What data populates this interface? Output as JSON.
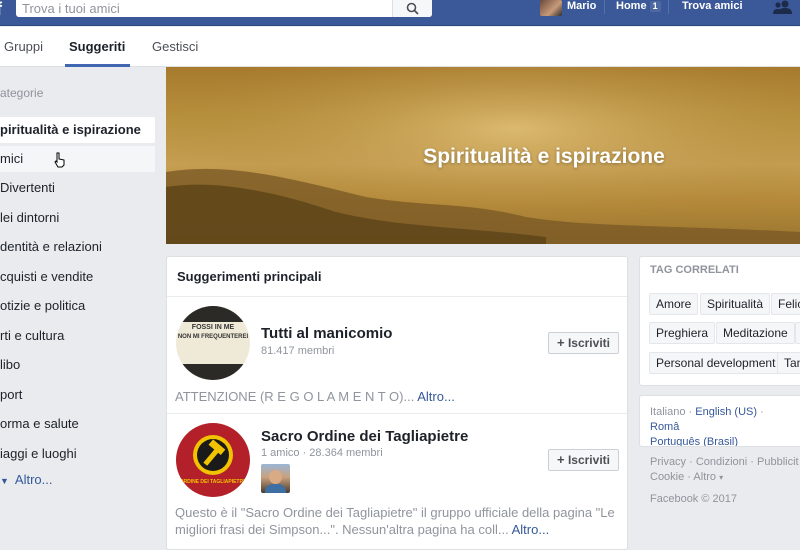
{
  "topbar": {
    "logo": "f",
    "search_placeholder": "Trova i tuoi amici",
    "user_name": "Mario",
    "home_label": "Home",
    "home_badge": "1",
    "find_friends_label": "Trova amici"
  },
  "tabs": [
    {
      "label": "Gruppi"
    },
    {
      "label": "Suggeriti"
    },
    {
      "label": "Gestisci"
    }
  ],
  "sidebar": {
    "title": "ategorie",
    "items": [
      {
        "label": "piritualità e ispirazione"
      },
      {
        "label": "mici"
      },
      {
        "label": "Divertenti"
      },
      {
        "label": "lei dintorni"
      },
      {
        "label": "dentità e relazioni"
      },
      {
        "label": "cquisti e vendite"
      },
      {
        "label": "otizie e politica"
      },
      {
        "label": "rti e cultura"
      },
      {
        "label": "libo"
      },
      {
        "label": "port"
      },
      {
        "label": "orma e salute"
      },
      {
        "label": "iaggi e luoghi"
      }
    ],
    "more_label": "Altro..."
  },
  "banner": {
    "title": "Spiritualità e ispirazione"
  },
  "suggestions": {
    "header": "Suggerimenti principali",
    "join_label": "Iscriviti",
    "groups": [
      {
        "name": "Tutti al manicomio",
        "members": "81.417 membri",
        "image_text_1": "FOSSI IN ME",
        "image_text_2": "NON MI FREQUENTEREI",
        "description": "ATTENZIONE (R E G O L A M E N T O)...",
        "more": "Altro..."
      },
      {
        "name": "Sacro Ordine dei Tagliapietre",
        "members": "1 amico · 28.364 membri",
        "image_text_1": "ORDINE DEI TAGLIAPIETRE",
        "description": "Questo è il \"Sacro Ordine dei Tagliapietre\" il gruppo ufficiale della pagina \"Le migliori frasi dei Simpson...\". Nessun'altra pagina ha coll...",
        "more": "Altro..."
      }
    ]
  },
  "related_tags": {
    "title": "TAG CORRELATI",
    "tags": [
      "Amore",
      "Spiritualità",
      "Felic",
      "Preghiera",
      "Meditazione",
      "Personal development",
      "Tan"
    ]
  },
  "languages": {
    "current": "Italiano",
    "others": [
      "English (US)",
      "Româ",
      "Português (Brasil)"
    ]
  },
  "footer": {
    "links": [
      "Privacy",
      "Condizioni",
      "Pubblicit",
      "Cookie",
      "Altro"
    ],
    "copyright": "Facebook © 2017"
  },
  "colors": {
    "brand": "#3b5998",
    "link": "#365899",
    "accent": "#4267b2"
  }
}
